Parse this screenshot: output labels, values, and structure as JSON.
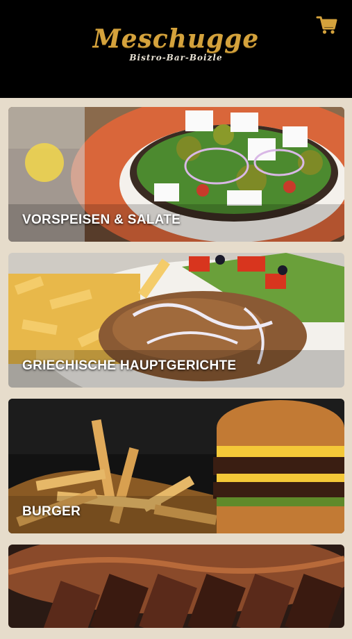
{
  "header": {
    "brand_name": "Meschugge",
    "brand_subtitle": "Bistro-Bar-Boizle",
    "cart_icon": "shopping-cart-icon"
  },
  "colors": {
    "header_bg": "#000000",
    "brand_gold": "#d4a23c",
    "page_bg": "#e6dccb",
    "label_text": "#ffffff"
  },
  "categories": [
    {
      "label": "VORSPEISEN & SALATE"
    },
    {
      "label": "GRIECHISCHE HAUPTGERICHTE"
    },
    {
      "label": "BURGER"
    },
    {
      "label": ""
    }
  ]
}
